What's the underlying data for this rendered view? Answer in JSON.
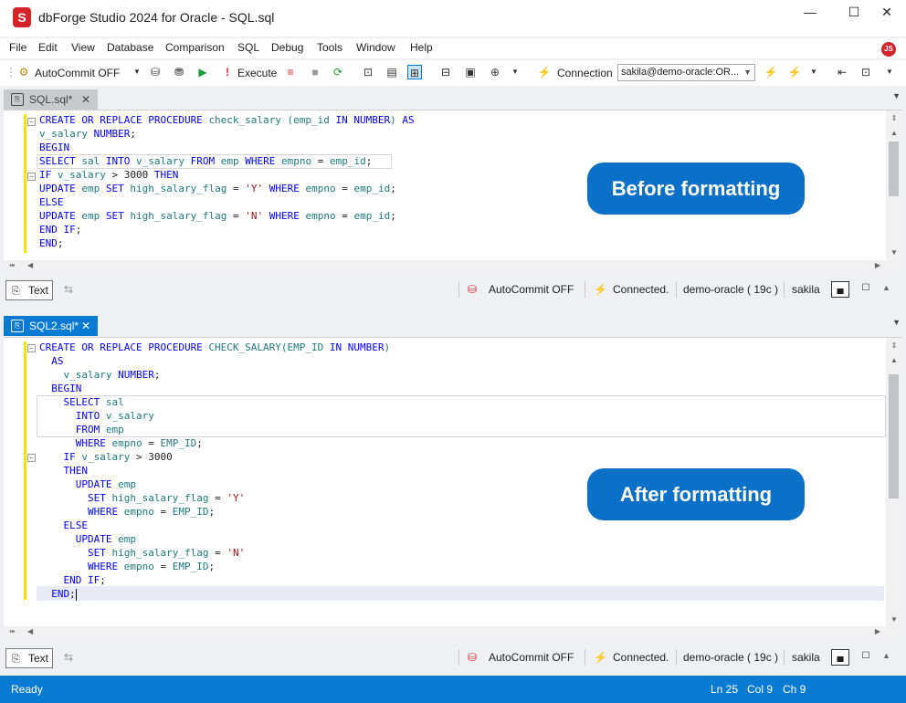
{
  "window": {
    "title": "dbForge Studio 2024 for Oracle - SQL.sql",
    "logo_letter": "S",
    "minimize": "—",
    "maximize": "☐",
    "close": "✕"
  },
  "menu": {
    "items": [
      "File",
      "Edit",
      "View",
      "Database",
      "Comparison",
      "SQL",
      "Debug",
      "Tools",
      "Window",
      "Help"
    ],
    "user_initials": "JS"
  },
  "toolbar": {
    "autocommit_label": "AutoCommit OFF",
    "execute_label": "Execute",
    "connection_label": "Connection",
    "connection_value": "sakila@demo-oracle:OR..."
  },
  "tabs": {
    "first": {
      "label": "SQL.sql*",
      "close": "✕"
    },
    "second": {
      "label": "SQL2.sql*",
      "close": "✕"
    }
  },
  "editor1": {
    "callout": "Before formatting",
    "lines": [
      "CREATE OR REPLACE PROCEDURE check_salary (emp_id IN NUMBER) AS",
      "v_salary NUMBER;",
      "BEGIN",
      "SELECT sal INTO v_salary FROM emp WHERE empno = emp_id;",
      "IF v_salary > 3000 THEN",
      "UPDATE emp SET high_salary_flag = 'Y' WHERE empno = emp_id;",
      "ELSE",
      "UPDATE emp SET high_salary_flag = 'N' WHERE empno = emp_id;",
      "END IF;",
      "END;"
    ]
  },
  "editor2": {
    "callout": "After formatting",
    "lines": [
      "CREATE OR REPLACE PROCEDURE CHECK_SALARY(EMP_ID IN NUMBER)",
      "  AS",
      "    v_salary NUMBER;",
      "  BEGIN",
      "    SELECT sal",
      "      INTO v_salary",
      "      FROM emp",
      "      WHERE empno = EMP_ID;",
      "    IF v_salary > 3000",
      "    THEN",
      "      UPDATE emp",
      "        SET high_salary_flag = 'Y'",
      "        WHERE empno = EMP_ID;",
      "    ELSE",
      "      UPDATE emp",
      "        SET high_salary_flag = 'N'",
      "        WHERE empno = EMP_ID;",
      "    END IF;",
      "  END;"
    ]
  },
  "doc_status": {
    "text_button": "Text",
    "autocommit": "AutoCommit OFF",
    "connected": "Connected.",
    "server": "demo-oracle ( 19c )",
    "schema": "sakila"
  },
  "statusbar": {
    "state": "Ready",
    "ln": "Ln 25",
    "col": "Col 9",
    "ch": "Ch 9"
  },
  "colors": {
    "accent": "#0a7bd3",
    "callout": "#0a70c8",
    "keyword": "#0000ff",
    "identifier": "#1f7a7a",
    "change_bar": "#f5e400"
  }
}
